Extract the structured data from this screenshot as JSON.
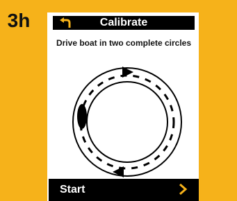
{
  "step": {
    "label": "3h"
  },
  "header": {
    "title": "Calibrate",
    "back_icon": "back-arrow-icon"
  },
  "instruction": {
    "text": "Drive boat in two complete circles"
  },
  "footer": {
    "start_label": "Start",
    "chevron_icon": "chevron-right-icon"
  },
  "colors": {
    "accent": "#f6b21a",
    "bar": "#000000",
    "text": "#111111"
  }
}
